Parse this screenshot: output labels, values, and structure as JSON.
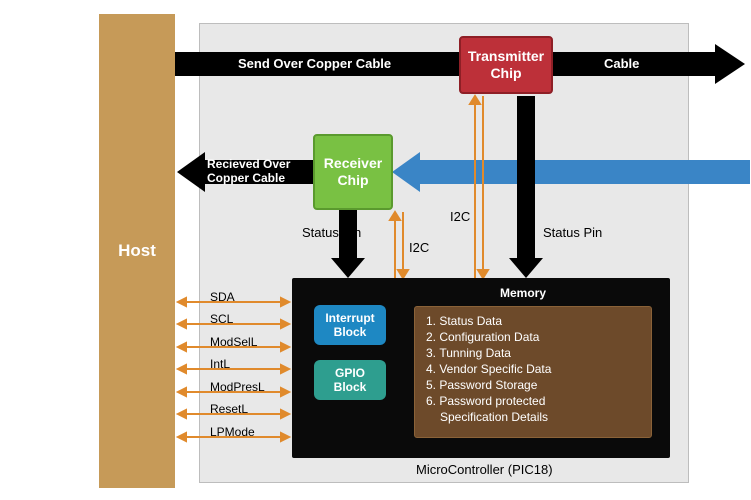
{
  "host": {
    "label": "Host"
  },
  "modules": {
    "transmitter": {
      "line1": "Transmitter",
      "line2": "Chip"
    },
    "receiver": {
      "line1": "Receiver",
      "line2": "Chip"
    },
    "interrupt": {
      "line1": "Interrupt",
      "line2": "Block"
    },
    "gpio": {
      "line1": "GPIO",
      "line2": "Block"
    }
  },
  "memory": {
    "title": "Memory",
    "items": [
      "Status Data",
      "Configuration Data",
      "Tunning Data",
      "Vendor Specific Data",
      "Password Storage",
      "Password protected",
      "Specification Details"
    ]
  },
  "labels": {
    "send_over_copper": "Send Over Copper Cable",
    "cable": "Cable",
    "recv_over_copper_l1": "Recieved Over",
    "recv_over_copper_l2": "Copper Cable",
    "status_pin_rx": "Status Pin",
    "status_pin_tx": "Status Pin",
    "i2c_rx": "I2C",
    "i2c_tx": "I2C",
    "mcu_caption": "MicroController (PIC18)"
  },
  "signals": [
    "SDA",
    "SCL",
    "ModSelL",
    "IntL",
    "ModPresL",
    "ResetL",
    "LPMode"
  ],
  "colors": {
    "grey": "#e8e8e8",
    "host": "#c69a58",
    "tx": "#bd3039",
    "rx": "#79c143",
    "mcu": "#0a0a0a",
    "interrupt": "#1e88c3",
    "gpio": "#2e9e8f",
    "memory": "#6d4a2a",
    "arrow_black": "#000000",
    "arrow_blue": "#3a85c6",
    "arrow_orange": "#e08a2c"
  }
}
